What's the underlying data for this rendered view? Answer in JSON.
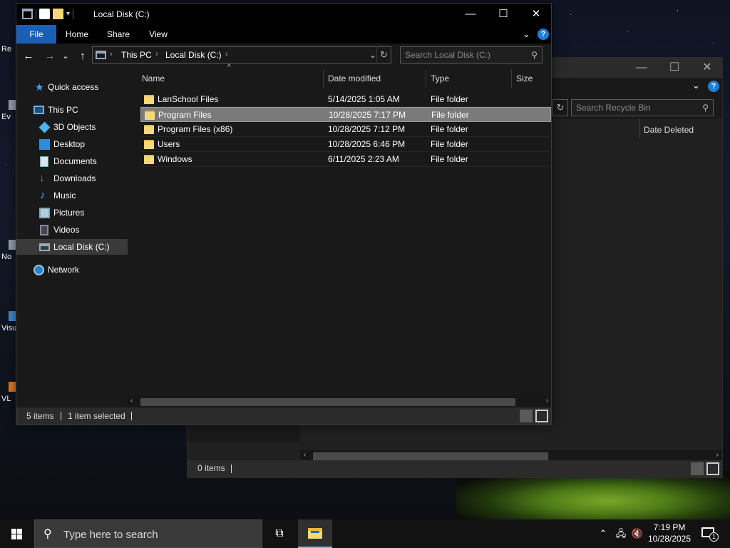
{
  "desktop": {
    "icons": [
      {
        "label": "Re",
        "name": "desktop-icon-recycle-bin"
      },
      {
        "label": "Ev",
        "name": "desktop-icon-ev"
      },
      {
        "label": "No",
        "name": "desktop-icon-no"
      },
      {
        "label": "Visu",
        "name": "desktop-icon-visual-studio"
      },
      {
        "label": "VL",
        "name": "desktop-icon-vlc"
      }
    ]
  },
  "recycle_bin": {
    "search_placeholder": "Search Recycle Bin",
    "column_date_deleted": "Date Deleted",
    "status_items": "0 items",
    "refresh_glyph": "↻",
    "search_glyph": "⚲",
    "controls": {
      "min": "—",
      "max": "☐",
      "close": "✕"
    }
  },
  "explorer": {
    "title": "Local Disk (C:)",
    "controls": {
      "min": "—",
      "max": "☐",
      "close": "✕"
    },
    "ribbon": {
      "file": "File",
      "home": "Home",
      "share": "Share",
      "view": "View"
    },
    "ribbon_expand": "⌄",
    "help": "?",
    "nav_buttons": {
      "back": "←",
      "forward": "→",
      "recent": "⌄",
      "up": "↑"
    },
    "breadcrumb": [
      "This PC",
      "Local Disk (C:)"
    ],
    "address_dropdown": "⌄",
    "refresh_glyph": "↻",
    "search_placeholder": "Search Local Disk (C:)",
    "search_glyph": "⚲",
    "nav_pane": [
      {
        "label": "Quick access",
        "icon": "star-icon"
      },
      {
        "label": "This PC",
        "icon": "computer-icon"
      },
      {
        "label": "3D Objects",
        "icon": "cube-icon"
      },
      {
        "label": "Desktop",
        "icon": "desktop-folder-icon"
      },
      {
        "label": "Documents",
        "icon": "documents-icon"
      },
      {
        "label": "Downloads",
        "icon": "downloads-icon"
      },
      {
        "label": "Music",
        "icon": "music-icon"
      },
      {
        "label": "Pictures",
        "icon": "pictures-icon"
      },
      {
        "label": "Videos",
        "icon": "videos-icon"
      },
      {
        "label": "Local Disk (C:)",
        "icon": "drive-icon",
        "selected": true
      },
      {
        "label": "Network",
        "icon": "network-icon"
      }
    ],
    "columns": {
      "name": "Name",
      "date_modified": "Date modified",
      "type": "Type",
      "size": "Size"
    },
    "sort_indicator": "^",
    "files": [
      {
        "name": "LanSchool Files",
        "date": "5/14/2025 1:05 AM",
        "type": "File folder"
      },
      {
        "name": "Program Files",
        "date": "10/28/2025 7:17 PM",
        "type": "File folder",
        "selected": true
      },
      {
        "name": "Program Files (x86)",
        "date": "10/28/2025 7:12 PM",
        "type": "File folder"
      },
      {
        "name": "Users",
        "date": "10/28/2025 6:46 PM",
        "type": "File folder"
      },
      {
        "name": "Windows",
        "date": "6/11/2025 2:23 AM",
        "type": "File folder"
      }
    ],
    "scroll_left": "‹",
    "scroll_right": "›",
    "status": {
      "count": "5 items",
      "selected": "1 item selected"
    }
  },
  "taskbar": {
    "search_placeholder": "Type here to search",
    "search_glyph": "⚲",
    "task_view_glyph": "⧉",
    "tray_chevron": "⌃",
    "clock": {
      "time": "7:19 PM",
      "date": "10/28/2025"
    },
    "notification_count": "1"
  },
  "colors": {
    "accent": "#1a5fb4",
    "window_bg": "#191919",
    "titlebar": "#000000",
    "selection": "#7a7a7a",
    "folder": "#f7d777"
  }
}
